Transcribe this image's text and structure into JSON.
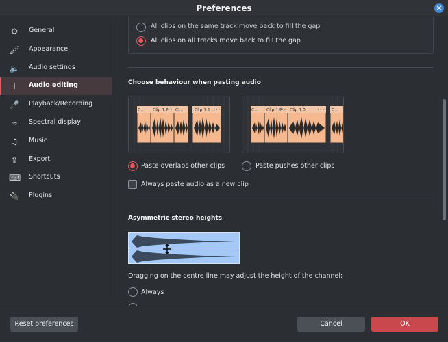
{
  "window": {
    "title": "Preferences"
  },
  "sidebar": {
    "items": [
      {
        "label": "General",
        "icon": "gear-icon",
        "glyph": "⚙"
      },
      {
        "label": "Appearance",
        "icon": "brush-icon",
        "glyph": "🖌"
      },
      {
        "label": "Audio settings",
        "icon": "speaker-icon",
        "glyph": "🔈"
      },
      {
        "label": "Audio editing",
        "icon": "text-cursor-icon",
        "glyph": "I"
      },
      {
        "label": "Playback/Recording",
        "icon": "microphone-icon",
        "glyph": "🎤"
      },
      {
        "label": "Spectral display",
        "icon": "waves-icon",
        "glyph": "≈"
      },
      {
        "label": "Music",
        "icon": "music-note-icon",
        "glyph": "♫"
      },
      {
        "label": "Export",
        "icon": "export-icon",
        "glyph": "⇪"
      },
      {
        "label": "Shortcuts",
        "icon": "keyboard-icon",
        "glyph": "⌨"
      },
      {
        "label": "Plugins",
        "icon": "plug-icon",
        "glyph": "🔌"
      }
    ],
    "active_index": 3
  },
  "content": {
    "gap_options": [
      {
        "label": "All clips on the same track move back to fill the gap",
        "selected": false
      },
      {
        "label": "All clips on all tracks move back to fill the gap",
        "selected": true
      }
    ],
    "paste_section": {
      "heading": "Choose behaviour when pasting audio",
      "preview_left_clips": [
        "C...",
        "Clip 1.2",
        "Cl...",
        "Clip 1.1"
      ],
      "preview_right_clips": [
        "C...",
        "Clip 1.2",
        "Clip 1.0",
        "C..."
      ],
      "options": [
        {
          "label": "Paste overlaps other clips",
          "selected": true
        },
        {
          "label": "Paste pushes other clips",
          "selected": false
        }
      ],
      "checkbox_label": "Always paste audio as a new clip",
      "checkbox_checked": false
    },
    "stereo_section": {
      "heading": "Asymmetric stereo heights",
      "description": "Dragging on the centre line may adjust the height of the channel:",
      "options": [
        {
          "label": "Always",
          "selected": false
        }
      ]
    }
  },
  "footer": {
    "reset_label": "Reset preferences",
    "cancel_label": "Cancel",
    "ok_label": "OK"
  },
  "colors": {
    "accent": "#e0575c",
    "clip": "#f6b98f",
    "clip_header": "#f2c6a6",
    "stereo_bg": "#a4c9f7"
  }
}
